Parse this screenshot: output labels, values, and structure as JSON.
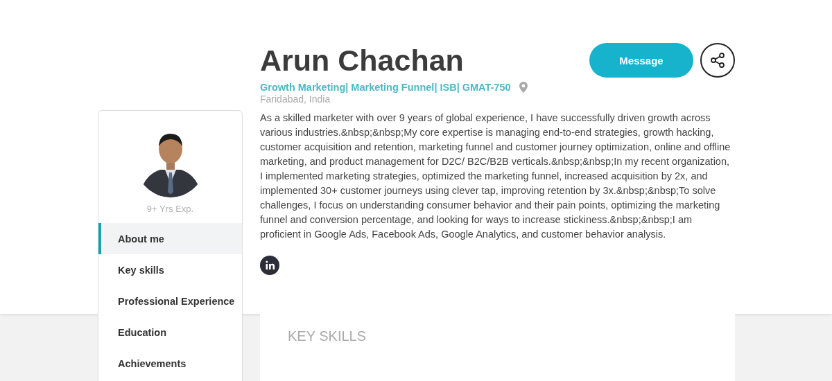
{
  "profile": {
    "name": "Arun Chachan",
    "headline": "Growth Marketing| Marketing Funnel| ISB| GMAT-750",
    "location": "Faridabad, India",
    "experience": "9+ Yrs Exp.",
    "about": "As a skilled marketer with over 9 years of global experience, I have successfully driven growth across various industries.&nbsp;&nbsp;My core expertise is managing end-to-end strategies, growth hacking, customer acquisition and retention, marketing funnel and customer journey optimization, online and offline marketing, and product management for D2C/ B2C/B2B verticals.&nbsp;&nbsp;In my recent organization, I implemented marketing strategies, optimized the marketing funnel, increased acquisition by 2x, and implemented 30+ customer journeys using clever tap, improving retention by 3x.&nbsp;&nbsp;To solve challenges, I focus on understanding consumer behavior and their pain points, optimizing the marketing funnel and conversion percentage, and looking for ways to increase stickiness.&nbsp;&nbsp;I am proficient in Google Ads, Facebook Ads, Google Analytics, and customer behavior analysis."
  },
  "actions": {
    "message_button": "Message"
  },
  "nav": [
    {
      "label": "About me",
      "selected": true
    },
    {
      "label": "Key skills",
      "selected": false
    },
    {
      "label": "Professional Experience",
      "selected": false
    },
    {
      "label": "Education",
      "selected": false
    },
    {
      "label": "Achievements",
      "selected": false
    }
  ],
  "key_skills": {
    "title": "KEY SKILLS"
  }
}
